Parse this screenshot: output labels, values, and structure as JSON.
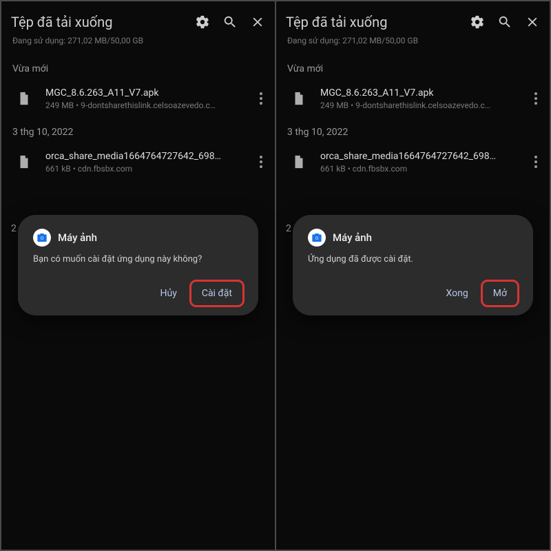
{
  "left": {
    "header": {
      "title": "Tệp đã tải xuống"
    },
    "storage": "Đang sử dụng: 271,02 MB/50,00 GB",
    "sections": [
      {
        "label": "Vừa mới",
        "file": {
          "name": "MGC_8.6.263_A11_V7.apk",
          "meta": "249 MB • 9-dontsharethislink.celsoazevedo.c…"
        }
      },
      {
        "label": "3 thg 10, 2022",
        "file": {
          "name": "orca_share_media1664764727642_698…",
          "meta": "661 kB • cdn.fbsbx.com"
        }
      }
    ],
    "peek": "2",
    "dialog": {
      "title": "Máy ảnh",
      "body": "Bạn có muốn cài đặt ứng dụng này không?",
      "cancel": "Hủy",
      "confirm": "Cài đặt"
    }
  },
  "right": {
    "header": {
      "title": "Tệp đã tải xuống"
    },
    "storage": "Đang sử dụng: 271,02 MB/50,00 GB",
    "sections": [
      {
        "label": "Vừa mới",
        "file": {
          "name": "MGC_8.6.263_A11_V7.apk",
          "meta": "249 MB • 9-dontsharethislink.celsoazevedo.c…"
        }
      },
      {
        "label": "3 thg 10, 2022",
        "file": {
          "name": "orca_share_media1664764727642_698…",
          "meta": "661 kB • cdn.fbsbx.com"
        }
      }
    ],
    "peek": "2",
    "dialog": {
      "title": "Máy ảnh",
      "body": "Ứng dụng đã được cài đặt.",
      "cancel": "Xong",
      "confirm": "Mở"
    }
  }
}
